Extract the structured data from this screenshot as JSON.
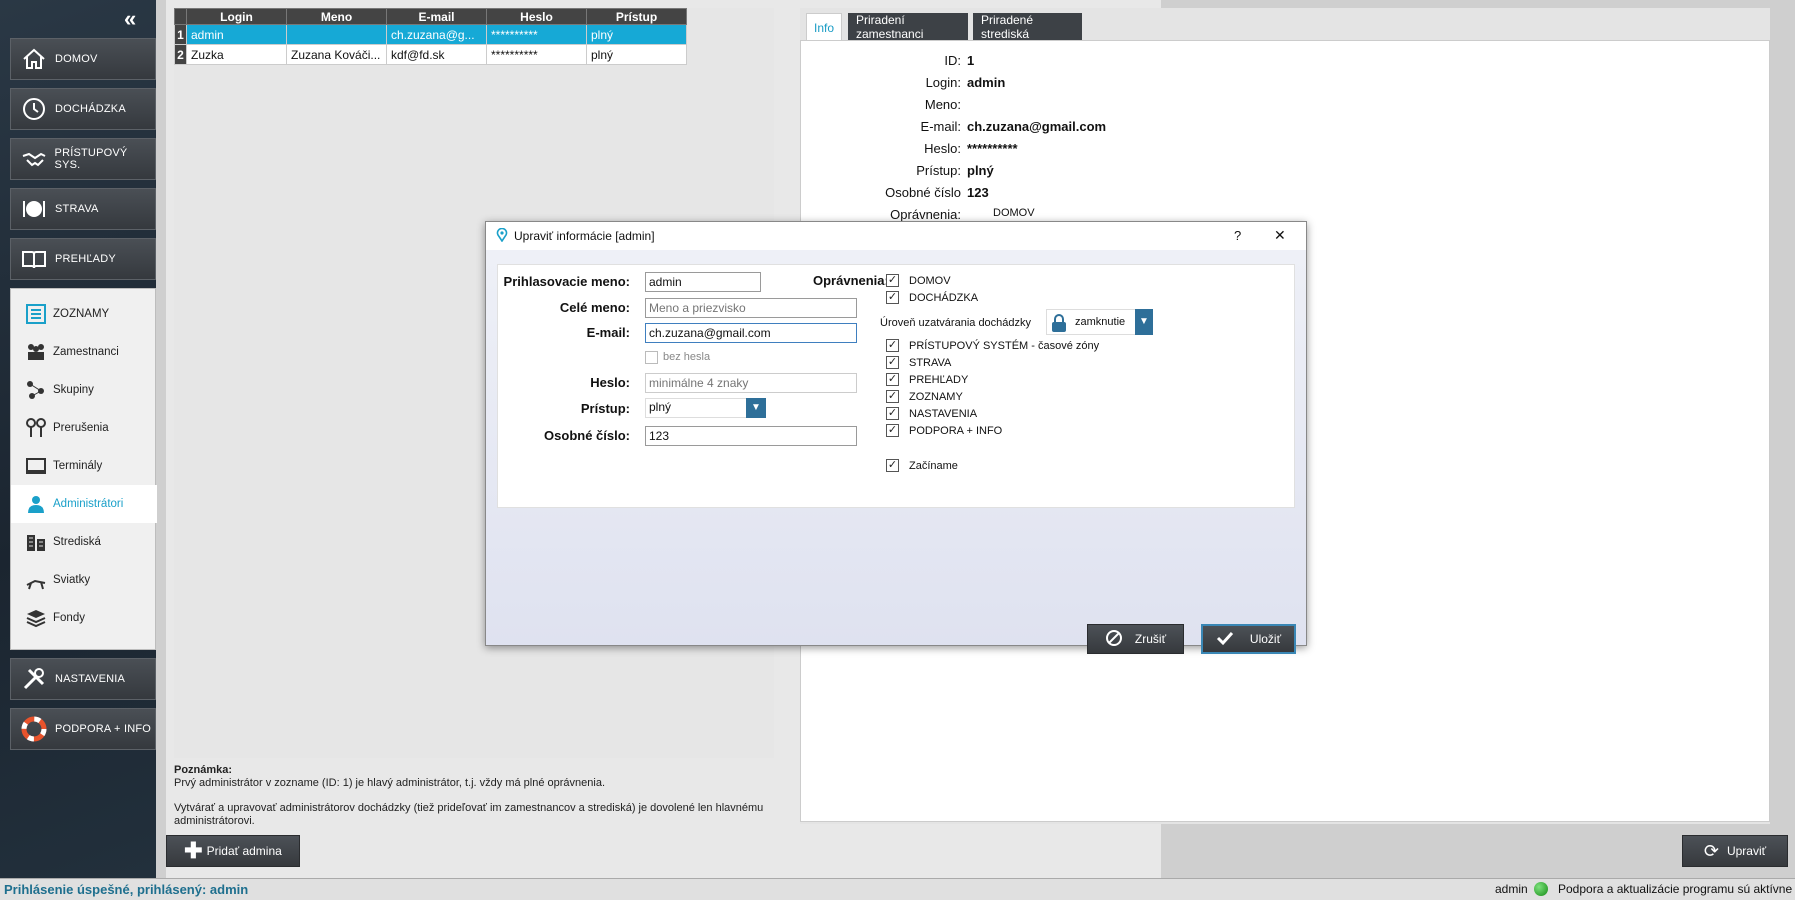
{
  "sidebar": {
    "collapse_glyph": "«",
    "nav": [
      {
        "label": "DOMOV",
        "icon": "home-icon"
      },
      {
        "label": "DOCHÁDZKA",
        "icon": "clock-icon"
      },
      {
        "label": "PRÍSTUPOVÝ SYS.",
        "icon": "handshake-icon"
      },
      {
        "label": "STRAVA",
        "icon": "plate-icon"
      },
      {
        "label": "PREHĽADY",
        "icon": "book-icon"
      }
    ],
    "sub": [
      {
        "label": "ZOZNAMY",
        "icon": "list-icon"
      },
      {
        "label": "Zamestnanci",
        "icon": "people-icon"
      },
      {
        "label": "Skupiny",
        "icon": "groups-icon"
      },
      {
        "label": "Prerušenia",
        "icon": "pins-icon"
      },
      {
        "label": "Terminály",
        "icon": "terminal-icon"
      },
      {
        "label": "Administrátori",
        "icon": "admin-icon"
      },
      {
        "label": "Strediská",
        "icon": "building-icon"
      },
      {
        "label": "Sviatky",
        "icon": "lounge-icon"
      },
      {
        "label": "Fondy",
        "icon": "layers-icon"
      }
    ],
    "bottom": [
      {
        "label": "NASTAVENIA",
        "icon": "tools-icon"
      },
      {
        "label": "PODPORA + INFO",
        "icon": "lifebuoy-icon"
      }
    ]
  },
  "table": {
    "headers": [
      "Login",
      "Meno",
      "E-mail",
      "Heslo",
      "Prístup"
    ],
    "rows": [
      {
        "n": "1",
        "login": "admin",
        "meno": "",
        "email": "ch.zuzana@g...",
        "heslo": "**********",
        "pristup": "plný"
      },
      {
        "n": "2",
        "login": "Zuzka",
        "meno": "Zuzana Kováči...",
        "email": "kdf@fd.sk",
        "heslo": "**********",
        "pristup": "plný"
      }
    ]
  },
  "note": {
    "title": "Poznámka:",
    "line1": "Prvý administrátor v zozname (ID: 1) je hlavý administrátor, t.j. vždy má plné oprávnenia.",
    "line2": "Vytvárať a upravovať administrátorov dochádzky (tiež prideľovať im zamestnancov a strediská) je dovolené len hlavnému administrátorovi."
  },
  "add_button": "Pridať admina",
  "edit_button": "Upraviť",
  "tabs": [
    "Info",
    "Priradení zamestnanci",
    "Priradené strediská"
  ],
  "info": {
    "rows": [
      {
        "label": "ID:",
        "value": "1"
      },
      {
        "label": "Login:",
        "value": "admin"
      },
      {
        "label": "Meno:",
        "value": ""
      },
      {
        "label": "E-mail:",
        "value": "ch.zuzana@gmail.com"
      },
      {
        "label": "Heslo:",
        "value": "**********"
      },
      {
        "label": "Prístup:",
        "value": "plný"
      },
      {
        "label": "Osobné číslo",
        "value": "123"
      }
    ],
    "perm_label": "Oprávnenia:",
    "perm_first": "DOMOV"
  },
  "dialog": {
    "title": "Upraviť informácie [admin]",
    "help": "?",
    "close": "✕",
    "login_label": "Prihlasovacie meno:",
    "login_value": "admin",
    "name_label": "Celé meno:",
    "name_placeholder": "Meno a priezvisko",
    "email_label": "E-mail:",
    "email_value": "ch.zuzana@gmail.com",
    "nopass_label": "bez hesla",
    "pass_label": "Heslo:",
    "pass_placeholder": "minimálne 4 znaky",
    "access_label": "Prístup:",
    "access_value": "plný",
    "number_label": "Osobné číslo:",
    "number_value": "123",
    "perm_label": "Oprávnenia:",
    "perms": [
      "DOMOV",
      "DOCHÁDZKA"
    ],
    "level_label": "Úroveň uzatvárania dochádzky",
    "level_value": "zamknutie",
    "perms2": [
      "PRÍSTUPOVÝ SYSTÉM - časové zóny",
      "STRAVA",
      "PREHĽADY",
      "ZOZNAMY",
      "NASTAVENIA",
      "PODPORA + INFO"
    ],
    "perm_last": "Začíname",
    "cancel": "Zrušiť",
    "save": "Uložiť"
  },
  "status": {
    "left": "Prihlásenie úspešné, prihlásený: admin",
    "user": "admin",
    "right": "Podpora a aktualizácie programu sú aktívne"
  },
  "colors": {
    "accent": "#1aa0c9",
    "selection": "#16a9d6",
    "arrow": "#22c55e",
    "status_text": "#1e6f8e"
  }
}
